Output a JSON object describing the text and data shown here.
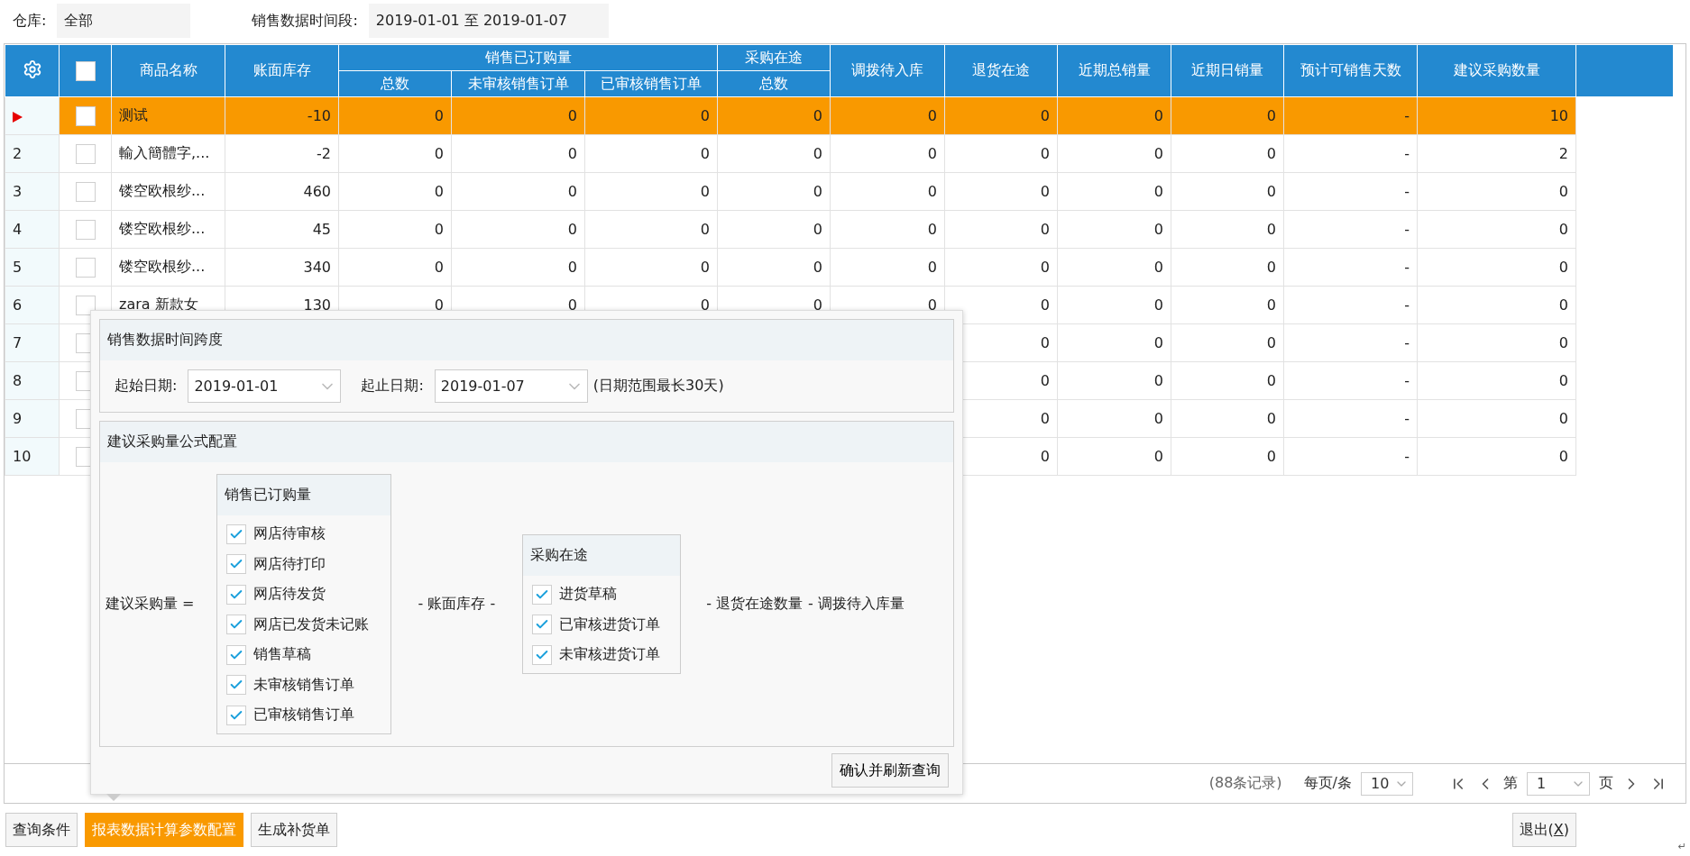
{
  "filters": [
    {
      "label": "仓库:",
      "value": "全部"
    },
    {
      "label": "销售数据时间段:",
      "value": "2019-01-01 至 2019-01-07"
    }
  ],
  "table": {
    "all_checked": false,
    "header": [
      {
        "kind": "single",
        "label": "商品名称"
      },
      {
        "kind": "single",
        "label": "账面库存"
      },
      {
        "kind": "group",
        "label": "销售已订购量",
        "children": [
          "总数",
          "未审核销售订单",
          "已审核销售订单"
        ]
      },
      {
        "kind": "group",
        "label": "采购在途",
        "children": [
          "总数"
        ]
      },
      {
        "kind": "single",
        "label": "调拨待入库"
      },
      {
        "kind": "single",
        "label": "退货在途"
      },
      {
        "kind": "single",
        "label": "近期总销量"
      },
      {
        "kind": "single",
        "label": "近期日销量"
      },
      {
        "kind": "single",
        "label": "预计可销售天数"
      },
      {
        "kind": "single",
        "label": "建议采购数量"
      }
    ],
    "rows": [
      {
        "selected": true,
        "checked": false,
        "cells": [
          "测试",
          "-10",
          "0",
          "0",
          "0",
          "0",
          "0",
          "0",
          "0",
          "0",
          "-",
          "10"
        ]
      },
      {
        "index": "2",
        "selected": false,
        "checked": false,
        "cells": [
          "輸入簡體字,...",
          "-2",
          "0",
          "0",
          "0",
          "0",
          "0",
          "0",
          "0",
          "0",
          "-",
          "2"
        ]
      },
      {
        "index": "3",
        "selected": false,
        "checked": false,
        "cells": [
          "镂空欧根纱...",
          "460",
          "0",
          "0",
          "0",
          "0",
          "0",
          "0",
          "0",
          "0",
          "-",
          "0"
        ]
      },
      {
        "index": "4",
        "selected": false,
        "checked": false,
        "cells": [
          "镂空欧根纱...",
          "45",
          "0",
          "0",
          "0",
          "0",
          "0",
          "0",
          "0",
          "0",
          "-",
          "0"
        ]
      },
      {
        "index": "5",
        "selected": false,
        "checked": false,
        "cells": [
          "镂空欧根纱...",
          "340",
          "0",
          "0",
          "0",
          "0",
          "0",
          "0",
          "0",
          "0",
          "-",
          "0"
        ]
      },
      {
        "index": "6",
        "selected": false,
        "checked": false,
        "cells": [
          "zara 新款女",
          "130",
          "0",
          "0",
          "0",
          "0",
          "0",
          "0",
          "0",
          "0",
          "-",
          "0"
        ]
      },
      {
        "index": "7",
        "selected": false,
        "checked": false,
        "cells": [
          null,
          null,
          null,
          null,
          null,
          null,
          null,
          "0",
          "0",
          "0",
          "-",
          "0"
        ]
      },
      {
        "index": "8",
        "selected": false,
        "checked": false,
        "cells": [
          null,
          null,
          null,
          null,
          null,
          null,
          null,
          "0",
          "0",
          "0",
          "-",
          "0"
        ]
      },
      {
        "index": "9",
        "selected": false,
        "checked": false,
        "cells": [
          null,
          null,
          null,
          null,
          null,
          null,
          null,
          "0",
          "0",
          "0",
          "-",
          "0"
        ]
      },
      {
        "index": "10",
        "selected": false,
        "checked": false,
        "cells": [
          null,
          null,
          null,
          null,
          null,
          null,
          null,
          "0",
          "0",
          "0",
          "-",
          "0"
        ]
      }
    ]
  },
  "pager": {
    "records": "(88条记录)",
    "per_page_label": "每页/条",
    "per_page": "10",
    "page_prefix": "第",
    "page": "1",
    "page_suffix": "页"
  },
  "config_popup": {
    "date_section": {
      "title": "销售数据时间跨度",
      "start_label": "起始日期:",
      "start": "2019-01-01",
      "end_label": "起止日期:",
      "end": "2019-01-07",
      "note": "(日期范围最长30天)"
    },
    "formula_section": {
      "title": "建议采购量公式配置",
      "lhs": "建议采购量 =",
      "groups": [
        {
          "title": "销售已订购量",
          "items": [
            {
              "label": "网店待审核",
              "checked": true
            },
            {
              "label": "网店待打印",
              "checked": true
            },
            {
              "label": "网店待发货",
              "checked": true
            },
            {
              "label": "网店已发货未记账",
              "checked": true
            },
            {
              "label": "销售草稿",
              "checked": true
            },
            {
              "label": "未审核销售订单",
              "checked": true
            },
            {
              "label": "已审核销售订单",
              "checked": true
            }
          ]
        },
        {
          "title": "采购在途",
          "items": [
            {
              "label": "进货草稿",
              "checked": true
            },
            {
              "label": "已审核进货订单",
              "checked": true
            },
            {
              "label": "未审核进货订单",
              "checked": true
            }
          ]
        }
      ],
      "middle": "- 账面库存 -",
      "tail": [
        "- 退货在途数量",
        "- 调拨待入库量"
      ]
    },
    "confirm_button": "确认并刷新查询"
  },
  "buttons": [
    {
      "label": "查询条件",
      "selected": false
    },
    {
      "label": "报表数据计算参数配置",
      "selected": true
    },
    {
      "label": "生成补货单",
      "selected": false
    }
  ],
  "exit_button": [
    "退出(",
    "X",
    ")"
  ],
  "corner_mark": "↵"
}
